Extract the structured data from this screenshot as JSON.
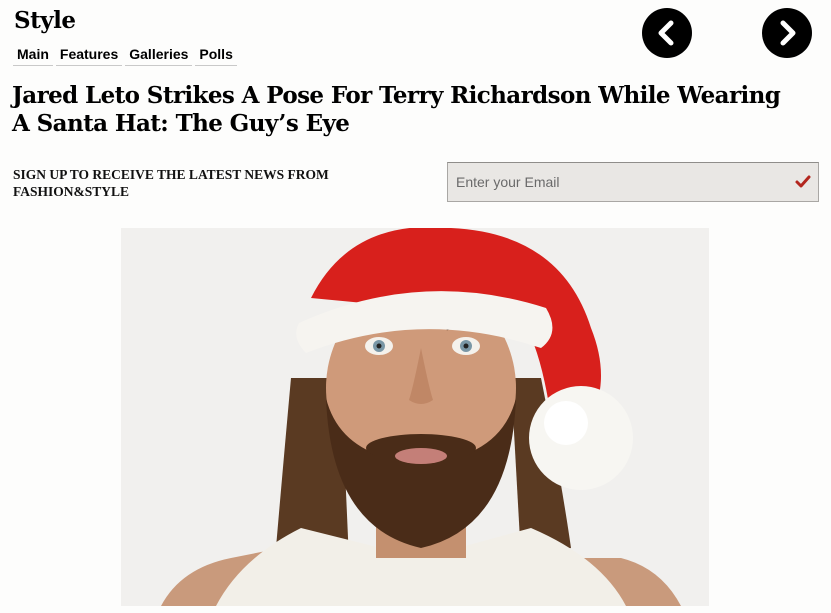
{
  "header": {
    "brand": "Style",
    "nav": [
      "Main",
      "Features",
      "Galleries",
      "Polls"
    ],
    "prev_icon": "chevron-left-icon",
    "next_icon": "chevron-right-icon"
  },
  "article": {
    "headline": "Jared Leto Strikes A Pose For Terry Richardson While Wearing A Santa Hat: The Guy’s Eye",
    "photo_subject": "Bearded man with long hair wearing a red Santa hat and white tank top"
  },
  "newsletter": {
    "prompt": "SIGN UP TO RECEIVE THE LATEST NEWS FROM FASHION&STYLE",
    "email_placeholder": "Enter your Email",
    "submit_icon": "checkmark-icon"
  },
  "colors": {
    "accent": "#b3261e",
    "arrow_bg": "#000000",
    "hat_red": "#d8201c"
  }
}
